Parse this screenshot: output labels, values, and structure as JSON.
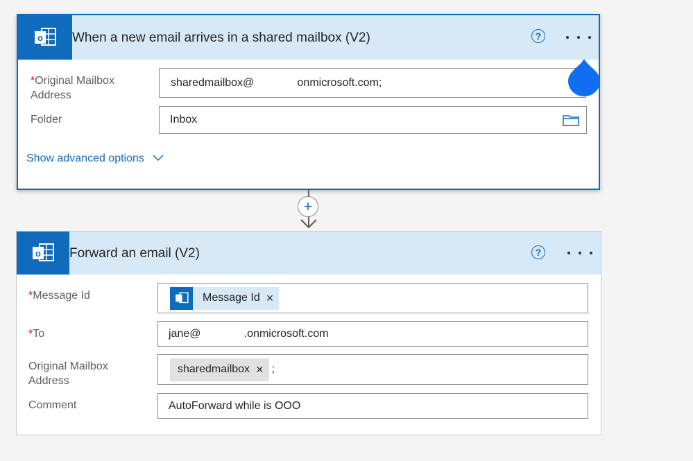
{
  "trigger": {
    "title": "When a new email arrives in a shared mailbox (V2)",
    "fields": {
      "mailbox_label": "Original Mailbox Address",
      "mailbox_value": "sharedmailbox@              onmicrosoft.com;",
      "folder_label": "Folder",
      "folder_value": "Inbox"
    },
    "advanced_link": "Show advanced options"
  },
  "action": {
    "title": "Forward an email (V2)",
    "fields": {
      "message_id_label": "Message Id",
      "message_id_token": "Message Id",
      "to_label": "To",
      "to_value": "jane@              .onmicrosoft.com",
      "mailbox_label": "Original Mailbox Address",
      "mailbox_token": "sharedmailbox",
      "mailbox_suffix": ";",
      "comment_label": "Comment",
      "comment_value": "AutoForward while is OOO"
    }
  },
  "symbols": {
    "required": "*",
    "help": "?",
    "add": "+",
    "remove": "×"
  },
  "colors": {
    "accent": "#0f6cbd",
    "header_bg": "#d7e8f6",
    "required": "#cc0000"
  }
}
